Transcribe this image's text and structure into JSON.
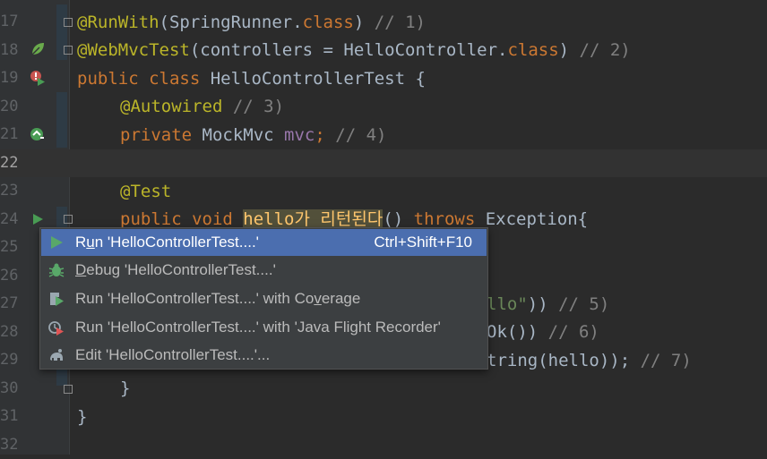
{
  "editor": {
    "line_numbers": [
      "17",
      "18",
      "19",
      "20",
      "21",
      "22",
      "23",
      "24",
      "25",
      "26",
      "27",
      "28",
      "29",
      "30",
      "31",
      "32"
    ],
    "lines": {
      "l17": {
        "a": "@RunWith",
        "b": "(SpringRunner.",
        "c": "class",
        "d": ") ",
        "e": "// 1)"
      },
      "l18": {
        "a": "@WebMvcTest",
        "b": "(controllers = HelloController.",
        "c": "class",
        "d": ") ",
        "e": "// 2)"
      },
      "l19": {
        "a": "public class ",
        "b": "HelloControllerTest {"
      },
      "l20": {
        "a": "@Autowired ",
        "b": "// 3)"
      },
      "l21": {
        "a": "private ",
        "b": "MockMvc ",
        "c": "mvc",
        "d": "; ",
        "e": "// 4)"
      },
      "l23": {
        "a": "@Test"
      },
      "l24": {
        "a": "public void ",
        "b": "hello가 리턴된다",
        "c": "() ",
        "d": "throws ",
        "e": "Exception{"
      },
      "l27": {
        "a": "llo\"",
        "b": ")) ",
        "c": "// 5)"
      },
      "l28": {
        "a": "Ok()) ",
        "b": "// 6)"
      },
      "l29": {
        "a": "tring(hello)); ",
        "b": "// 7)"
      },
      "l30": {
        "a": "}"
      },
      "l31": {
        "a": "}"
      }
    }
  },
  "context_menu": {
    "items": [
      {
        "pre": "R",
        "u": "u",
        "post": "n 'HelloControllerTest....'",
        "shortcut": "Ctrl+Shift+F10"
      },
      {
        "pre": "",
        "u": "D",
        "post": "ebug 'HelloControllerTest....'"
      },
      {
        "pre": "Run 'HelloControllerTest....' with Co",
        "u": "v",
        "post": "erage"
      },
      {
        "pre": "Run 'HelloControllerTest....' with 'Java Flight Recorder'",
        "u": "",
        "post": ""
      },
      {
        "pre": "Edit 'HelloControllerTest....'...",
        "u": "",
        "post": ""
      }
    ]
  }
}
